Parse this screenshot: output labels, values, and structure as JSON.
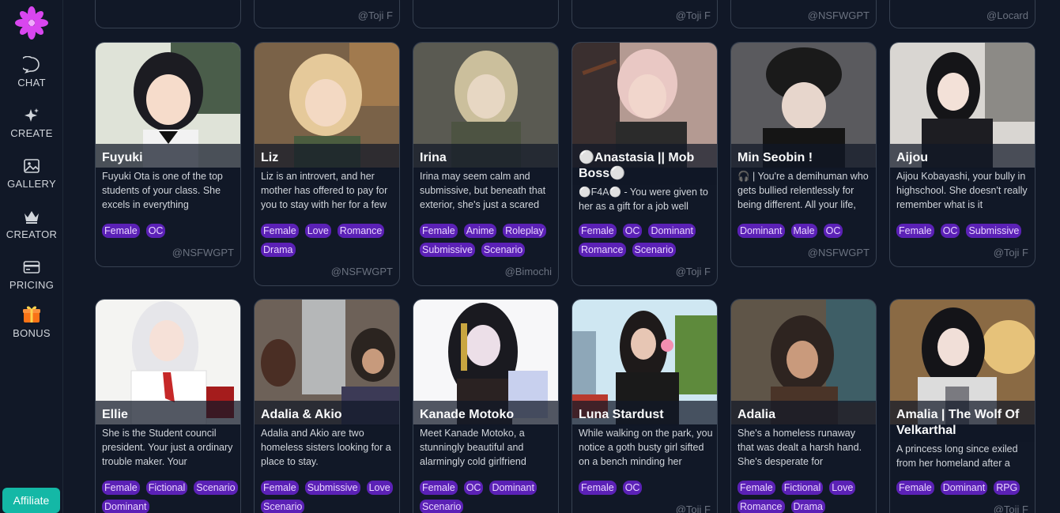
{
  "sidebar": {
    "items": [
      {
        "label": "CHAT",
        "icon": "chat-icon"
      },
      {
        "label": "CREATE",
        "icon": "sparkle-icon"
      },
      {
        "label": "GALLERY",
        "icon": "image-icon"
      },
      {
        "label": "CREATOR",
        "icon": "crown-icon"
      },
      {
        "label": "PRICING",
        "icon": "card-icon"
      },
      {
        "label": "BONUS",
        "icon": "gift-icon"
      }
    ],
    "affiliate_label": "Affiliate"
  },
  "top_row_authors": [
    "",
    "@Toji F",
    "",
    "@Toji F",
    "@NSFWGPT",
    "@Locard"
  ],
  "row1": [
    {
      "name": "Fuyuki",
      "desc": "Fuyuki Ota is one of the top students of your class. She excels in everything",
      "tags": [
        "Female",
        "OC"
      ],
      "author": "@NSFWGPT"
    },
    {
      "name": "Liz",
      "desc": "Liz is an introvert, and her mother has offered to pay for you to stay with her for a few",
      "tags": [
        "Female",
        "Love",
        "Romance",
        "Drama"
      ],
      "author": "@NSFWGPT"
    },
    {
      "name": "Irina",
      "desc": "Irina may seem calm and submissive, but beneath that exterior, she's just a scared",
      "tags": [
        "Female",
        "Anime",
        "Roleplay",
        "Submissive",
        "Scenario"
      ],
      "author": "@Bimochi"
    },
    {
      "name": "⚪Anastasia || Mob Boss⚪",
      "desc": "⚪F4A⚪ - You were given to her as a gift for a job well",
      "tags": [
        "Female",
        "OC",
        "Dominant",
        "Romance",
        "Scenario"
      ],
      "author": "@Toji F"
    },
    {
      "name": "Min Seobin !",
      "desc": "🎧 | You're a demihuman who gets bullied relentlessly for being different. All your life,",
      "tags": [
        "Dominant",
        "Male",
        "OC"
      ],
      "author": "@NSFWGPT"
    },
    {
      "name": "Aijou",
      "desc": "Aijou Kobayashi, your bully in highschool. She doesn't really remember what is it",
      "tags": [
        "Female",
        "OC",
        "Submissive"
      ],
      "author": "@Toji F"
    }
  ],
  "row2": [
    {
      "name": "Ellie",
      "desc": "She is the Student council president. Your just a ordinary trouble maker. Your",
      "tags": [
        "Female",
        "Fictional",
        "Scenario",
        "Dominant"
      ],
      "author": ""
    },
    {
      "name": "Adalia & Akio",
      "desc": "Adalia and Akio are two homeless sisters looking for a place to stay.",
      "tags": [
        "Female",
        "Submissive",
        "Love",
        "Scenario"
      ],
      "author": ""
    },
    {
      "name": "Kanade Motoko",
      "desc": "Meet Kanade Motoko, a stunningly beautiful and alarmingly cold girlfriend",
      "tags": [
        "Female",
        "OC",
        "Dominant",
        "Scenario"
      ],
      "author": ""
    },
    {
      "name": "Luna Stardust",
      "desc": "While walking on the park, you notice a goth busty girl sifted on a bench minding her",
      "tags": [
        "Female",
        "OC"
      ],
      "author": "@Toji F"
    },
    {
      "name": "Adalia",
      "desc": "She's a homeless runaway that was dealt a harsh hand. She's desperate for",
      "tags": [
        "Female",
        "Fictional",
        "Love",
        "Romance",
        "Drama"
      ],
      "author": ""
    },
    {
      "name": "Amalia | The Wolf Of Velkarthal",
      "desc": "A princess long since exiled from her homeland after a",
      "tags": [
        "Female",
        "Dominant",
        "RPG"
      ],
      "author": "@Toji F"
    }
  ],
  "colors": {
    "background": "#111827",
    "tag": "#5b21b6",
    "affiliate": "#14b8a6",
    "logo": "#d946ef"
  }
}
